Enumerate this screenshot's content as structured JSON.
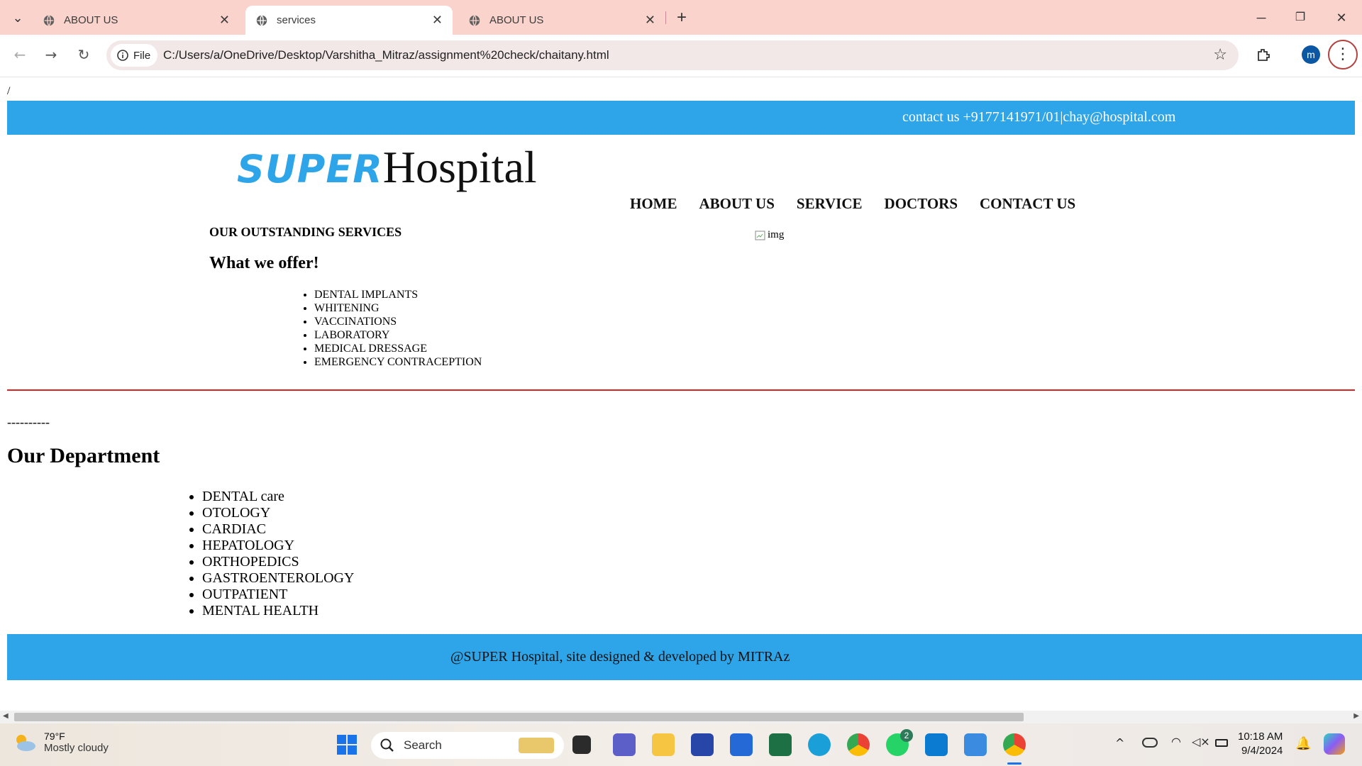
{
  "browser": {
    "tabs": [
      {
        "label": "ABOUT US",
        "active": false
      },
      {
        "label": "services",
        "active": true
      },
      {
        "label": "ABOUT US",
        "active": false
      }
    ],
    "url_scheme_label": "File",
    "url": "C:/Users/a/OneDrive/Desktop/Varshitha_Mitraz/assignment%20check/chaitany.html",
    "profile_initial": "m"
  },
  "page": {
    "slash": "/",
    "contact": "contact us +9177141971/01|chay@hospital.com",
    "logo_super": "SUPER",
    "logo_hospital": "Hospital",
    "nav": [
      "HOME",
      "ABOUT US",
      "SERVICE",
      "DOCTORS",
      "CONTACT US"
    ],
    "services_heading": "OUR OUTSTANDING SERVICES",
    "offer_heading": "What we offer!",
    "image_alt": "img",
    "offer_items": [
      "DENTAL IMPLANTS",
      "WHITENING",
      "VACCINATIONS",
      "LABORATORY",
      "MEDICAL DRESSAGE",
      "EMERGENCY CONTRACEPTION"
    ],
    "dashes": "----------",
    "department_heading": "Our Department",
    "department_items": [
      "DENTAL care",
      "OTOLOGY",
      "CARDIAC",
      "HEPATOLOGY",
      "ORTHOPEDICS",
      "GASTROENTEROLOGY",
      "OUTPATIENT",
      "MENTAL HEALTH"
    ],
    "footer": "@SUPER Hospital, site designed & developed by MITRAz",
    "colors": {
      "accent": "#2ea5e8",
      "divider": "#dd2222"
    }
  },
  "taskbar": {
    "temperature": "79°F",
    "weather": "Mostly cloudy",
    "search_placeholder": "Search",
    "whatsapp_badge": "2",
    "time": "10:18 AM",
    "date": "9/4/2024"
  }
}
